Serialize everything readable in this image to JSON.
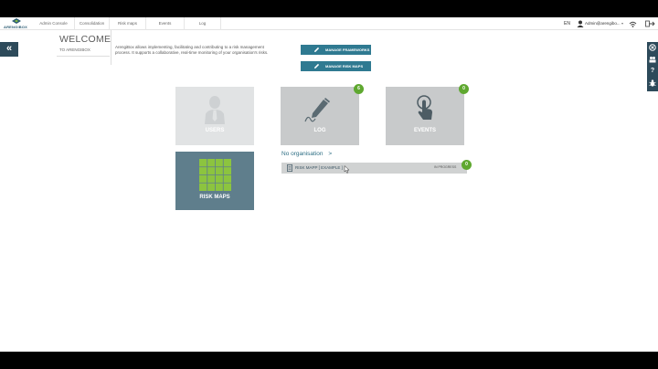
{
  "brand": {
    "name": "ARENGIBOX",
    "color": "#2d5d74",
    "accent": "#8cc43f"
  },
  "nav": {
    "items": [
      {
        "label": "Admin Console"
      },
      {
        "label": "Consolidation"
      },
      {
        "label": "Risk maps"
      },
      {
        "label": "Events"
      },
      {
        "label": "Log"
      }
    ],
    "language": "EN",
    "user_name": "Admin@arengibo..."
  },
  "welcome": {
    "title": "WELCOME",
    "subtitle": "TO ARENGIBOX",
    "description": "ArengiBox allows implementing, facilitating and contributing to a risk management process. It supports a collaborative, real-time monitoring of your organisation's risks."
  },
  "actions": {
    "manage_frameworks": "MANAGE FRAMEWORKS",
    "manage_risk_maps": "MANAGE RISK MAPS"
  },
  "tiles": {
    "users": {
      "label": "USERS",
      "color": "#e1e3e4"
    },
    "log": {
      "label": "LOG",
      "badge": "6",
      "color": "#c8cacb"
    },
    "events": {
      "label": "EVENTS",
      "badge": "0",
      "color": "#c8cacb"
    },
    "risk_maps": {
      "label": "RISK MAPS",
      "color": "#5f7e8c"
    }
  },
  "organisation": {
    "label": "No organisation",
    "arrow": ">",
    "maps": [
      {
        "name": "RISK MAPP [ EXAMPLE ]",
        "status": "IN PROGRESS",
        "badge": "0"
      }
    ]
  },
  "icons": {
    "collapse": "«",
    "help": "?"
  },
  "colors": {
    "primary_dark": "#2d4a5a",
    "button_teal": "#2f7a91",
    "badge_green": "#5fa830",
    "grid_green": "#8cc43f"
  }
}
